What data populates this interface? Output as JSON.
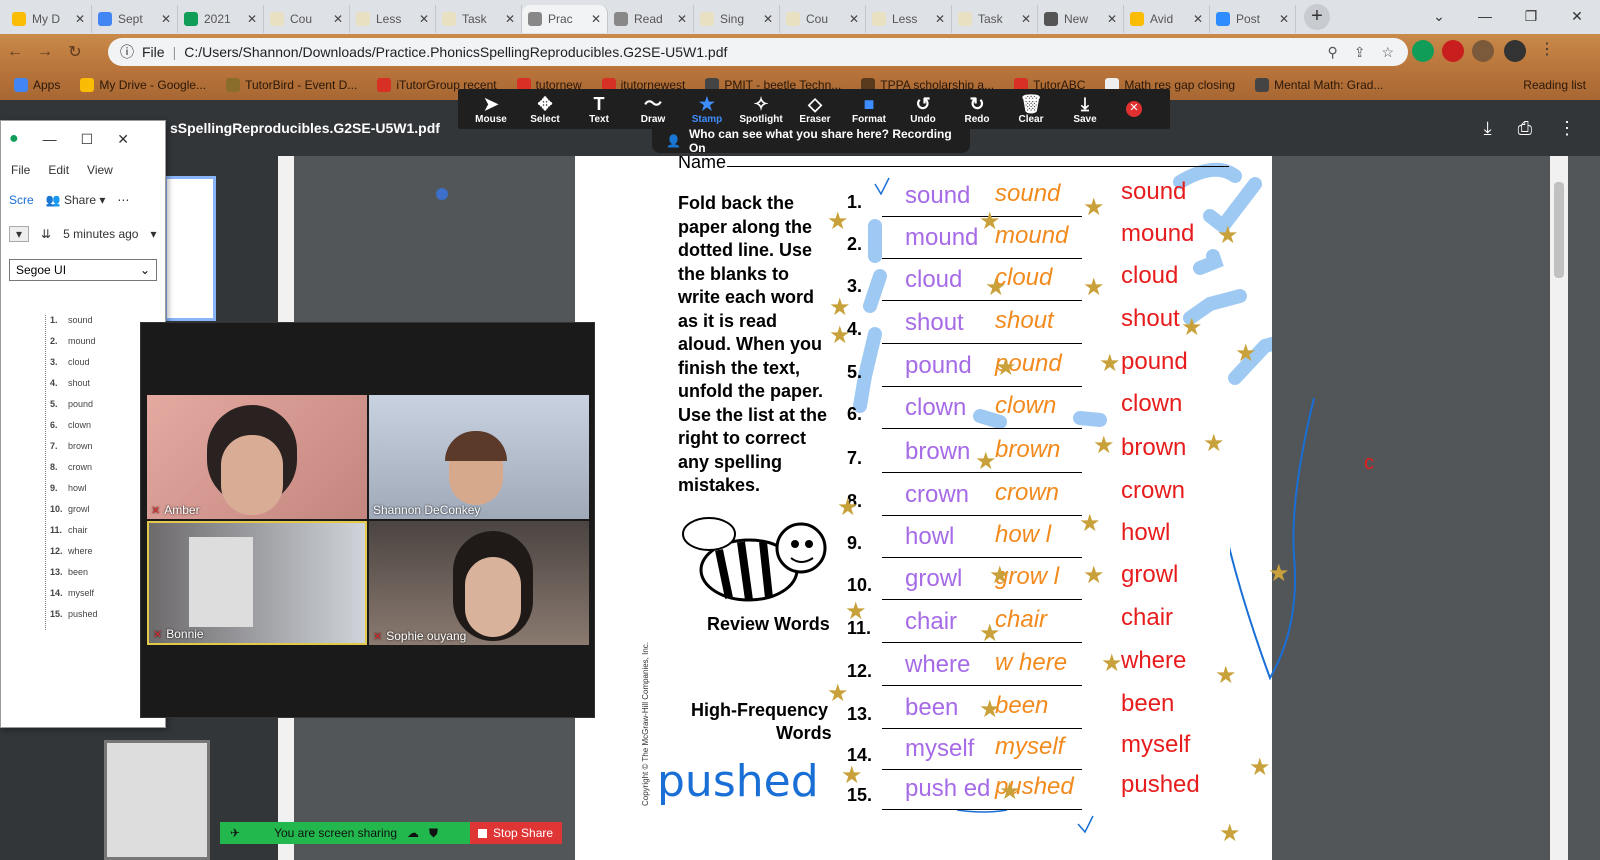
{
  "browser": {
    "tabs": [
      {
        "label": "My D",
        "color": "#fbbc05"
      },
      {
        "label": "Sept",
        "color": "#4285f4"
      },
      {
        "label": "2021",
        "color": "#0f9d58"
      },
      {
        "label": "Cou",
        "color": "#e8e0c0"
      },
      {
        "label": "Less",
        "color": "#e8e0c0"
      },
      {
        "label": "Task",
        "color": "#e8e0c0"
      },
      {
        "label": "Prac",
        "color": "#888888"
      },
      {
        "label": "Read",
        "color": "#888888"
      },
      {
        "label": "Sing",
        "color": "#e8e0c0"
      },
      {
        "label": "Cou",
        "color": "#e8e0c0"
      },
      {
        "label": "Less",
        "color": "#e8e0c0"
      },
      {
        "label": "Task",
        "color": "#e8e0c0"
      },
      {
        "label": "New",
        "color": "#555555"
      },
      {
        "label": "Avid",
        "color": "#fbbc05"
      },
      {
        "label": "Post",
        "color": "#2d8cff"
      }
    ],
    "address_scheme": "File",
    "address": "C:/Users/Shannon/Downloads/Practice.PhonicsSpellingReproducibles.G2SE-U5W1.pdf",
    "bookmarks": [
      {
        "label": "Apps",
        "color": "#4285f4"
      },
      {
        "label": "My Drive - Google...",
        "color": "#fbbc05"
      },
      {
        "label": "TutorBird - Event D...",
        "color": "#8a6d2b"
      },
      {
        "label": "iTutorGroup recent",
        "color": "#d93025"
      },
      {
        "label": "tutornew",
        "color": "#d93025"
      },
      {
        "label": "itutornewest",
        "color": "#d93025"
      },
      {
        "label": "PMIT - beetle Techn...",
        "color": "#444444"
      },
      {
        "label": "TPPA scholarship a...",
        "color": "#5a3a1c"
      },
      {
        "label": "TutorABC",
        "color": "#d93025"
      },
      {
        "label": "Math res gap closing",
        "color": "#eeeeee"
      },
      {
        "label": "Mental Math: Grad...",
        "color": "#444444"
      }
    ],
    "reading_list": "Reading list"
  },
  "pdf": {
    "title": "sSpellingReproducibles.G2SE-U5W1.pdf"
  },
  "zoom_toolbar": {
    "tools": [
      {
        "label": "Mouse",
        "icon": "arrow-icon"
      },
      {
        "label": "Select",
        "icon": "move-icon"
      },
      {
        "label": "Text",
        "icon": "text-icon"
      },
      {
        "label": "Draw",
        "icon": "draw-icon"
      },
      {
        "label": "Stamp",
        "icon": "star-icon"
      },
      {
        "label": "Spotlight",
        "icon": "spotlight-icon"
      },
      {
        "label": "Eraser",
        "icon": "eraser-icon"
      },
      {
        "label": "Format",
        "icon": "format-icon"
      },
      {
        "label": "Undo",
        "icon": "undo-icon"
      },
      {
        "label": "Redo",
        "icon": "redo-icon"
      },
      {
        "label": "Clear",
        "icon": "trash-icon"
      },
      {
        "label": "Save",
        "icon": "save-icon"
      }
    ],
    "active": "Stamp",
    "share_notice": "Who can see what you share here? Recording On"
  },
  "notes_app": {
    "menu": [
      "File",
      "Edit",
      "View"
    ],
    "scr_label": "Scre",
    "share_label": "Share",
    "saved": "5 minutes ago",
    "font": "Segoe UI",
    "words": [
      "sound",
      "mound",
      "cloud",
      "shout",
      "pound",
      "clown",
      "brown",
      "crown",
      "howl",
      "growl",
      "chair",
      "where",
      "been",
      "myself",
      "pushed"
    ]
  },
  "video": {
    "participants": [
      "Amber",
      "Shannon DeConkey",
      "Bonnie",
      "Sophie ouyang"
    ]
  },
  "sharing_bar": {
    "status": "You are screen sharing",
    "stop": "Stop Share"
  },
  "worksheet": {
    "name_label": "Name",
    "instructions": [
      "Fold back the",
      "paper along the",
      "dotted line. Use",
      "the blanks to",
      "write each word",
      "as it is read",
      "aloud. When you",
      "finish the text,",
      "unfold the paper.",
      "Use the list at the",
      "right to correct",
      "any spelling",
      "mistakes."
    ],
    "review_label": "Review Words",
    "hf_label_1": "High-Frequency",
    "hf_label_2": "Words",
    "copyright": "Copyright © The McGraw-Hill Companies, Inc.",
    "numbers": [
      "1.",
      "2.",
      "3.",
      "4.",
      "5.",
      "6.",
      "7.",
      "8.",
      "9.",
      "10.",
      "11.",
      "12.",
      "13.",
      "14.",
      "15."
    ],
    "purple": [
      "sound",
      "mound",
      "cloud",
      "shout",
      "pound",
      "clown",
      "brown",
      "crown",
      "howl",
      "growl",
      "chair",
      "where",
      "been",
      "myself",
      "push ed"
    ],
    "orange": [
      "sound",
      "mound",
      "cloud",
      "shout",
      "pound",
      "clown",
      "brown",
      "crown",
      "how l",
      "grow l",
      "chair",
      "w here",
      "been",
      "myself",
      "pushed"
    ],
    "red": [
      "sound",
      "mound",
      "cloud",
      "shout",
      "pound",
      "clown",
      "brown",
      "crown",
      "howl",
      "growl",
      "chair",
      "where",
      "been",
      "myself",
      "pushed"
    ],
    "blue_note": "pushed",
    "margin_letter": "c"
  }
}
